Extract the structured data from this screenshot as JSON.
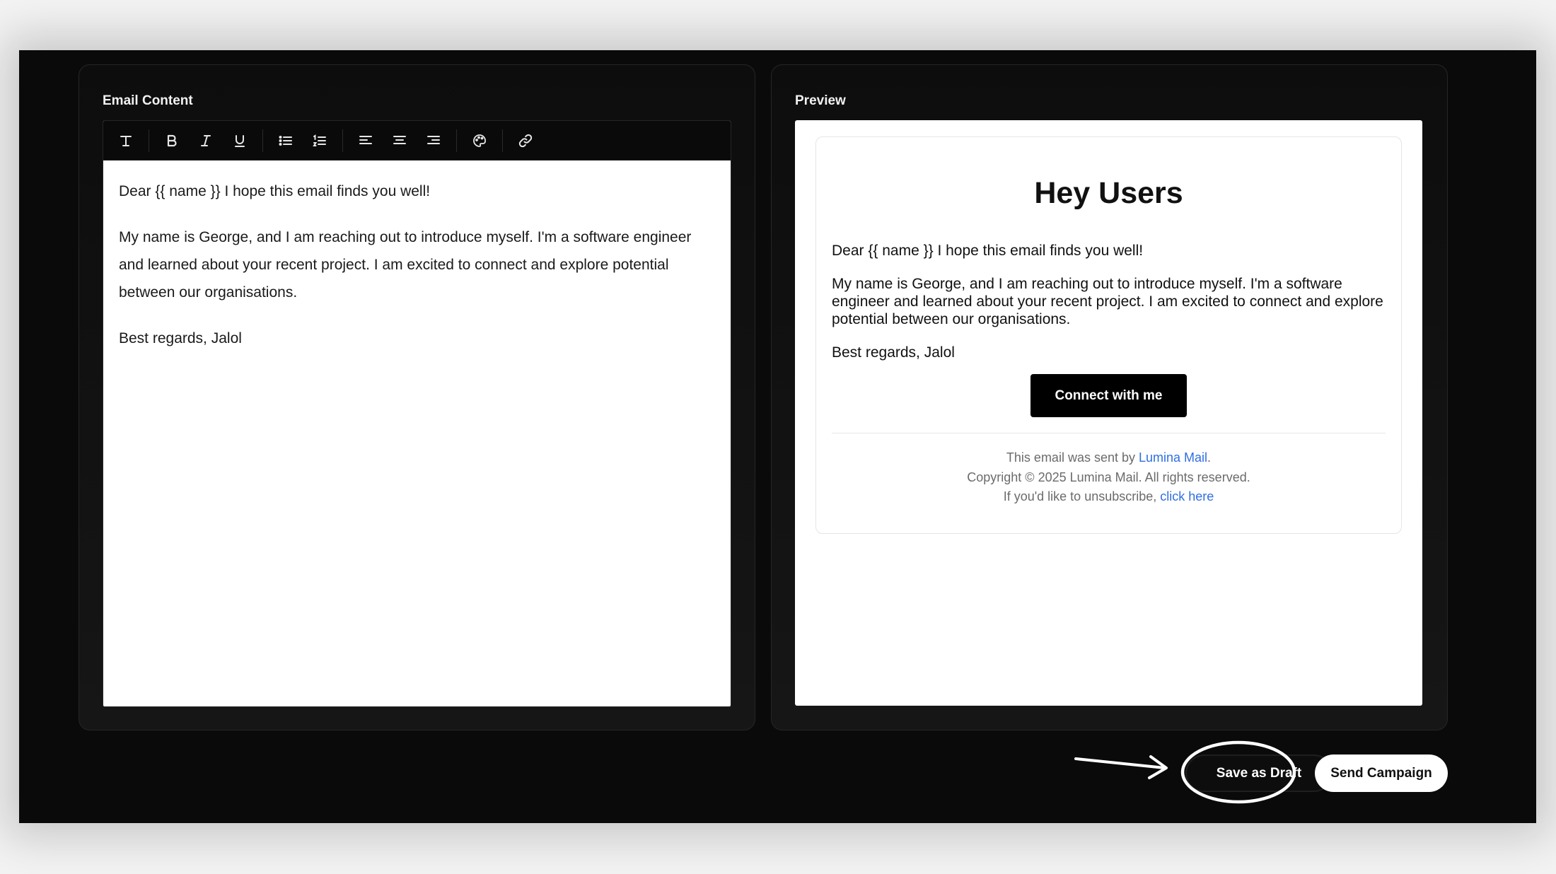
{
  "editor": {
    "title": "Email Content",
    "toolbar": [
      "text-icon",
      "bold-icon",
      "italic-icon",
      "underline-icon",
      "bullet-list-icon",
      "numbered-list-icon",
      "align-left-icon",
      "align-center-icon",
      "align-right-icon",
      "palette-icon",
      "link-icon"
    ],
    "paragraphs": [
      "Dear {{ name }} I hope this email finds you well!",
      "My name is George, and I am reaching out to introduce myself. I'm a software engineer and learned about your recent project. I am excited to connect and explore potential between our organisations.",
      "Best regards, Jalol"
    ]
  },
  "preview": {
    "title": "Preview",
    "heading": "Hey Users",
    "paragraphs": [
      "Dear {{ name }} I hope this email finds you well!",
      "My name is George, and I am reaching out to introduce myself. I'm a software engineer and learned about your recent project. I am excited to connect and explore potential between our organisations.",
      "Best regards, Jalol"
    ],
    "cta_label": "Connect with me",
    "footer": {
      "sent_by_prefix": "This email was sent by ",
      "sent_by_link": "Lumina Mail",
      "sent_by_suffix": ".",
      "copyright": "Copyright © 2025 Lumina Mail. All rights reserved.",
      "unsubscribe_prefix": "If you'd like to unsubscribe, ",
      "unsubscribe_link": "click here"
    }
  },
  "actions": {
    "draft_label": "Save as Draft",
    "send_label": "Send Campaign"
  },
  "colors": {
    "background": "#0a0a0a",
    "link": "#2f6fe0"
  }
}
